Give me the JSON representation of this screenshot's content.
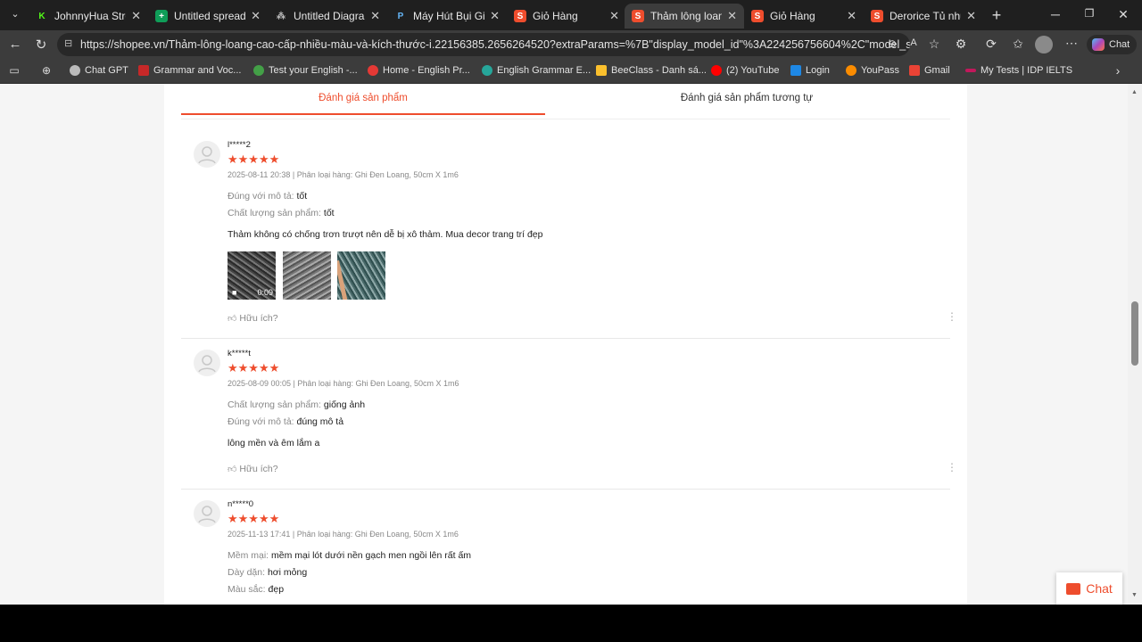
{
  "tabs": [
    {
      "title": "JohnnyHua Stream",
      "icon_color": "#53fc18",
      "letter": "K"
    },
    {
      "title": "Untitled spreadsheet",
      "icon_color": "#0f9d58",
      "letter": "+"
    },
    {
      "title": "Untitled Diagram -",
      "icon_color": "#555555",
      "letter": "⁂"
    },
    {
      "title": "Máy Hút Bụi Giường",
      "icon_color": "#1565c0",
      "letter": "P"
    },
    {
      "title": "Giỏ Hàng",
      "icon_color": "#ee4d2d",
      "letter": "S"
    },
    {
      "title": "Thảm lông loang c",
      "icon_color": "#ee4d2d",
      "letter": "S"
    },
    {
      "title": "Giỏ Hàng",
      "icon_color": "#ee4d2d",
      "letter": "S"
    },
    {
      "title": "Derorice Tủ nhựa g",
      "icon_color": "#ee4d2d",
      "letter": "S"
    }
  ],
  "url": "https://shopee.vn/Thảm-lông-loang-cao-cấp-nhiều-màu-và-kích-thước-i.22156385.2656264520?extraParams=%7B\"display_model_id\"%3A224256756604%2C\"model_select...",
  "copilot_label": "Chat",
  "bookmarks": [
    {
      "label": "Chat GPT",
      "color": "#bbbbbb"
    },
    {
      "label": "Grammar and Voc...",
      "color": "#c62828"
    },
    {
      "label": "Test your English -...",
      "color": "#43a047"
    },
    {
      "label": "Home - English Pr...",
      "color": "#e53935"
    },
    {
      "label": "English Grammar E...",
      "color": "#26a69a"
    },
    {
      "label": "BeeClass - Danh sá...",
      "color": "#fbc02d"
    },
    {
      "label": "(2) YouTube",
      "color": "#ff0000"
    },
    {
      "label": "Login",
      "color": "#1e88e5"
    },
    {
      "label": "YouPass",
      "color": "#fb8c00"
    },
    {
      "label": "Gmail",
      "color": "#ea4335"
    },
    {
      "label": "My Tests | IDP IELTS",
      "color": "#c2185b"
    }
  ],
  "review_tabs": {
    "tab1": "Đánh giá sản phẩm",
    "tab2": "Đánh giá sản phẩm tương tự"
  },
  "reviews": [
    {
      "user": "l*****2",
      "stars": "★★★★★",
      "meta": "2025-08-11 20:38 | Phân loại hàng: Ghi Đen Loang, 50cm X 1m6",
      "l1k": "Đúng với mô tả:",
      "l1v": "tốt",
      "l2k": "Chất lượng sản phẩm:",
      "l2v": "tốt",
      "text": "Thảm không có chống trơn trượt nên dễ bị xô thảm. Mua decor trang trí đẹp",
      "duration": "0:09",
      "helpful": "Hữu ích?"
    },
    {
      "user": "k*****t",
      "stars": "★★★★★",
      "meta": "2025-08-09 00:05 | Phân loại hàng: Ghi Đen Loang, 50cm X 1m6",
      "l1k": "Chất lượng sản phẩm:",
      "l1v": "giống ảnh",
      "l2k": "Đúng với mô tả:",
      "l2v": "đúng mô tả",
      "text": "lông mền và êm lắm a",
      "helpful": "Hữu ích?"
    },
    {
      "user": "n*****0",
      "stars": "★★★★★",
      "meta": "2025-11-13 17:41 | Phân loại hàng: Ghi Đen Loang, 50cm X 1m6",
      "l1k": "Mềm mại:",
      "l1v": "mềm mại lót dưới nền gạch men ngồi lên rất ấm",
      "l2k": "Dày dặn:",
      "l2v": "hơi mỏng",
      "l3k": "Màu sắc:",
      "l3v": "đẹp"
    }
  ],
  "chat_label": "Chat"
}
